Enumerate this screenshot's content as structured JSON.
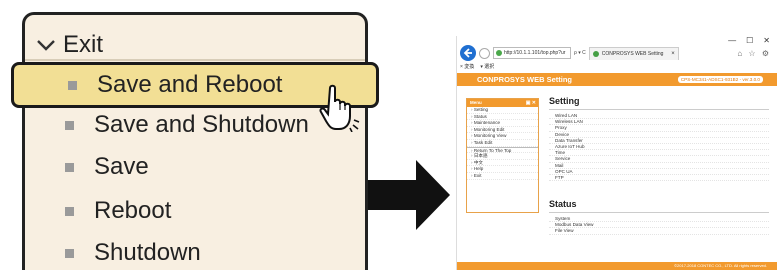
{
  "zoom_menu": {
    "exit_label": "Exit",
    "items": [
      {
        "label": "Save and Reboot",
        "highlighted": true
      },
      {
        "label": "Save and Shutdown",
        "highlighted": false
      },
      {
        "label": "Save",
        "highlighted": false
      },
      {
        "label": "Reboot",
        "highlighted": false
      },
      {
        "label": "Shutdown",
        "highlighted": false
      }
    ]
  },
  "browser": {
    "window_buttons": [
      "—",
      "☐",
      "✕"
    ],
    "url": "http://10.1.1.101/top.php?ur",
    "url_icons": "ρ ▾ C",
    "tab_title": "CONPROSYS WEB Setting",
    "favorites_bar": [
      "× 変換",
      "▾ 選択"
    ],
    "nav_icons": "⌂ ☆ ⚙",
    "app_title": "CONPROSYS WEB Setting",
    "app_version": "CPS-MC341-ADSC1-931B2 - ver.3.0.0",
    "side_menu": {
      "title": "Menu",
      "items": [
        "Setting",
        "Status",
        "Maintenance",
        "Monitoring Edit",
        "Monitoring View",
        "Task Edit",
        "Return To The Top",
        "日本語",
        "中文",
        "Help",
        "Exit"
      ]
    },
    "sections": [
      {
        "title": "Setting",
        "items": [
          "Wired LAN",
          "Wireless LAN",
          "Proxy",
          "Device",
          "Data Transfer",
          "Azure IoT Hub",
          "Time",
          "Service",
          "Mail",
          "OPC UA",
          "FTP"
        ]
      },
      {
        "title": "Status",
        "items": [
          "System",
          "Modbus Data View",
          "File View"
        ]
      }
    ],
    "footer": "©2017-2018 CONTEC CO., LTD. All rights reserved."
  },
  "colors": {
    "accent_orange": "#f29a2e",
    "highlight_yellow": "#f2df95",
    "panel_bg": "#f8efe1",
    "browser_blue": "#1f6fd1"
  }
}
